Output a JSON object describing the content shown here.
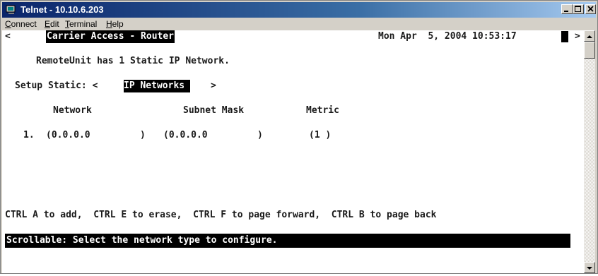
{
  "window": {
    "title": "Telnet - 10.10.6.203",
    "controls": [
      "minimize-icon",
      "maximize-icon",
      "close-icon"
    ]
  },
  "menu": [
    {
      "label": "Connect",
      "accel": "C",
      "rest": "onnect"
    },
    {
      "label": "Edit",
      "accel": "E",
      "rest": "dit"
    },
    {
      "label": "Terminal",
      "accel": "T",
      "rest": "erminal"
    },
    {
      "label": "Help",
      "accel": "H",
      "rest": "elp"
    }
  ],
  "terminal": {
    "header_left_arrow": "<",
    "header_title": "Carrier Access - Router",
    "header_datetime": "Mon Apr  5, 2004 10:53:17",
    "header_right_arrow": ">",
    "summary": "RemoteUnit has 1 Static IP Network.",
    "setup_label": "Setup Static: <",
    "setup_value": "IP Networks ",
    "setup_close": ">",
    "columns": {
      "network": "Network",
      "subnet": "Subnet Mask",
      "metric": "Metric"
    },
    "rows": [
      {
        "index": "1.",
        "network": "(0.0.0.0         )",
        "subnet": "(0.0.0.0         )",
        "metric": "(1 )"
      }
    ],
    "help": "CTRL A to add,  CTRL E to erase,  CTRL F to page forward,  CTRL B to page back",
    "status": "Scrollable: Select the network type to configure."
  },
  "colors": {
    "titlebar_start": "#0a246a",
    "titlebar_end": "#a6caf0",
    "chrome": "#d4d0c8",
    "terminal_bg": "#ffffff",
    "terminal_text": "#1a1a1a",
    "highlight_bg": "#000000"
  }
}
